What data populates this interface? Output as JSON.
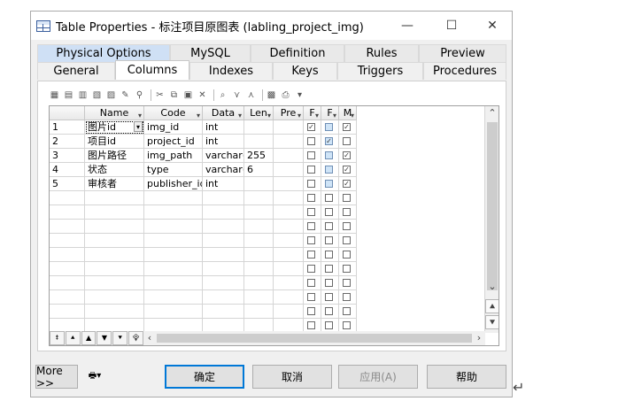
{
  "window": {
    "title": "Table Properties - 标注项目原图表 (labling_project_img)"
  },
  "titlebar_buttons": {
    "minimize": "—",
    "maximize": "☐",
    "close": "✕"
  },
  "tabs_back": [
    "Physical Options",
    "MySQL",
    "Definition",
    "Rules",
    "Preview"
  ],
  "tabs_front": [
    "General",
    "Columns",
    "Indexes",
    "Keys",
    "Triggers",
    "Procedures"
  ],
  "active_tab": "Columns",
  "toolbar_icons": [
    "properties-icon",
    "add-row-icon",
    "insert-row-icon",
    "add-rows-icon",
    "delete-row-icon",
    "customize-icon",
    "filter-icon",
    "cut-icon",
    "copy-icon",
    "paste-icon",
    "delete-icon",
    "find-icon",
    "show-filter-icon",
    "apply-filter-icon",
    "export-excel-icon",
    "print-icon",
    "dropdown-arrow-icon"
  ],
  "grid": {
    "headers": [
      "Name",
      "Code",
      "Data",
      "Len",
      "Pre",
      "F",
      "F",
      "M"
    ],
    "rows": [
      {
        "num": "1",
        "name": "图片id",
        "code": "img_id",
        "data": "int",
        "len": "",
        "pre": "",
        "p": true,
        "f": false,
        "m": true,
        "selected": true
      },
      {
        "num": "2",
        "name": "项目id",
        "code": "project_id",
        "data": "int",
        "len": "",
        "pre": "",
        "p": false,
        "f": true,
        "m": false
      },
      {
        "num": "3",
        "name": "图片路径",
        "code": "img_path",
        "data": "varchar(",
        "len": "255",
        "pre": "",
        "p": false,
        "f": false,
        "m": true
      },
      {
        "num": "4",
        "name": "状态",
        "code": "type",
        "data": "varchar(",
        "len": "6",
        "pre": "",
        "p": false,
        "f": false,
        "m": true
      },
      {
        "num": "5",
        "name": "审核者",
        "code": "publisher_id",
        "data": "int",
        "len": "",
        "pre": "",
        "p": false,
        "f": false,
        "m": true
      }
    ],
    "empty_rows": 10
  },
  "nav_buttons": [
    "⯒",
    "⯅",
    "▲",
    "▼",
    "⯆",
    "⯓"
  ],
  "buttons": {
    "more": "More >>",
    "ok": "确定",
    "cancel": "取消",
    "apply": "应用(A)",
    "help": "帮助"
  }
}
